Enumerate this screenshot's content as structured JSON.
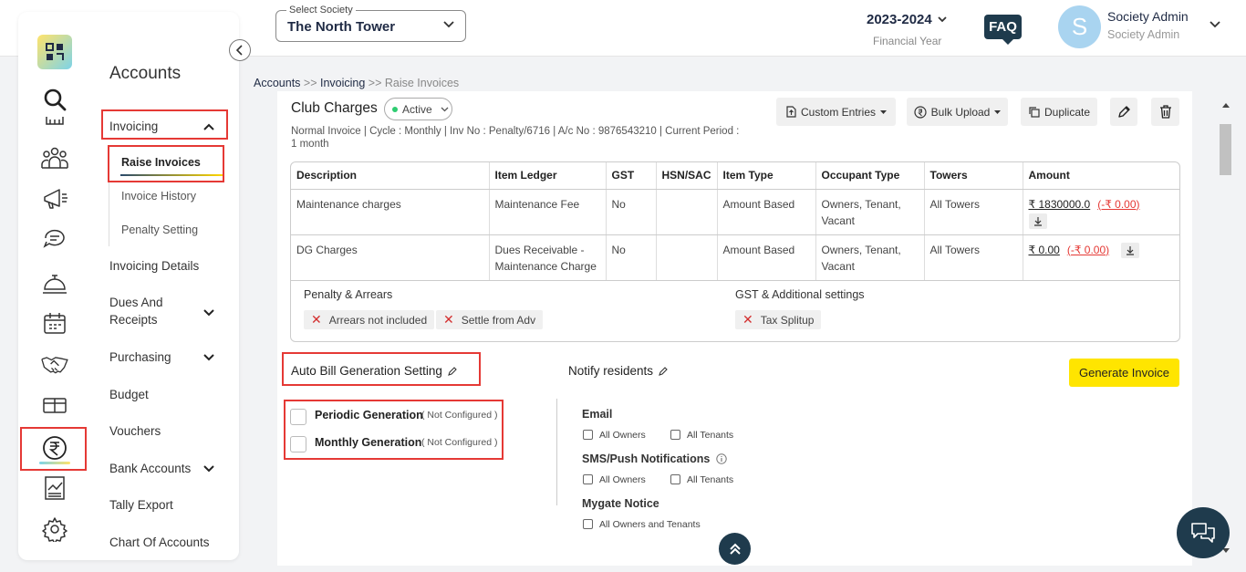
{
  "header": {
    "society_label": "Select Society",
    "society_value": "The North Tower",
    "financial_year": "2023-2024",
    "financial_year_label": "Financial Year",
    "faq": "FAQ",
    "avatar_letter": "S",
    "user_name": "Society Admin",
    "user_role": "Society Admin"
  },
  "rail": {
    "icons": [
      "search-icon",
      "community-icon",
      "megaphone-icon",
      "chat-icon",
      "bell-service-icon",
      "calendar-icon",
      "handshake-icon",
      "ticket-icon",
      "rupee-icon",
      "report-icon",
      "settings-icon"
    ],
    "active": "rupee-icon"
  },
  "menu": {
    "title": "Accounts",
    "invoicing": "Invoicing",
    "sub": {
      "raise": "Raise Invoices",
      "history": "Invoice History",
      "penalty": "Penalty Setting"
    },
    "invoicing_details": "Invoicing Details",
    "dues_line1": "Dues And",
    "dues_line2": "Receipts",
    "purchasing": "Purchasing",
    "budget": "Budget",
    "vouchers": "Vouchers",
    "bank_accounts": "Bank Accounts",
    "tally": "Tally Export",
    "chart_accounts": "Chart Of Accounts"
  },
  "breadcrumb": {
    "accounts": "Accounts",
    "sep": " >> ",
    "invoicing": "Invoicing",
    "current": "Raise Invoices"
  },
  "invoice": {
    "title": "Club Charges",
    "status": "Active",
    "meta": "Normal Invoice | Cycle : Monthly | Inv No : Penalty/6716 | A/c No : 9876543210 | Current Period : 1 month",
    "buttons": {
      "custom_entries": "Custom Entries",
      "bulk_upload": "Bulk Upload",
      "duplicate": "Duplicate"
    },
    "columns": [
      "Description",
      "Item Ledger",
      "GST",
      "HSN/SAC",
      "Item Type",
      "Occupant Type",
      "Towers",
      "Amount"
    ],
    "rows": [
      {
        "description": "Maintenance charges",
        "ledger": "Maintenance Fee",
        "gst": "No",
        "hsn": "",
        "item_type": "Amount Based",
        "occupant": "Owners, Tenant, Vacant",
        "towers": "All Towers",
        "amount": "₹ 1830000.0",
        "amount_adj": "(-₹ 0.00)"
      },
      {
        "description": "DG Charges",
        "ledger": "Dues Receivable - Maintenance Charge",
        "gst": "No",
        "hsn": "",
        "item_type": "Amount Based",
        "occupant": "Owners, Tenant, Vacant",
        "towers": "All Towers",
        "amount": "₹ 0.00",
        "amount_adj": "(-₹ 0.00)"
      }
    ],
    "penalty_label": "Penalty & Arrears",
    "penalty_chips": [
      "Arrears not included",
      "Settle from Adv"
    ],
    "gst_label": "GST & Additional settings",
    "gst_chips": [
      "Tax Splitup"
    ]
  },
  "auto_bill": {
    "title": "Auto Bill Generation Setting",
    "periodic": "Periodic Generation",
    "periodic_status": "( Not Configured )",
    "monthly": "Monthly Generation",
    "monthly_status": "( Not Configured )"
  },
  "notify": {
    "title": "Notify residents",
    "email": "Email",
    "sms": "SMS/Push Notifications",
    "mygate": "Mygate Notice",
    "all_owners": "All Owners",
    "all_tenants": "All Tenants",
    "all_owners_tenants": "All Owners and Tenants"
  },
  "generate_button": "Generate Invoice"
}
